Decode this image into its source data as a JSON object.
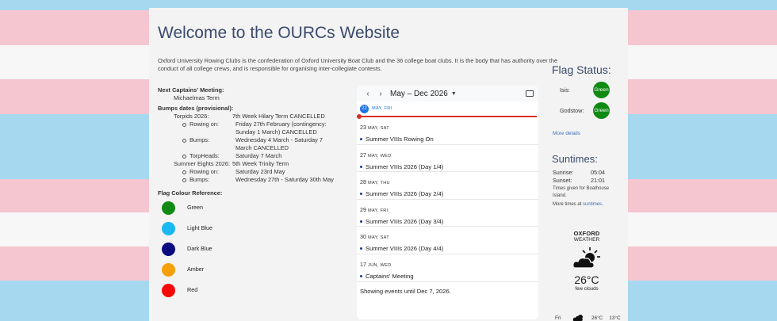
{
  "title": "Welcome to the OURCs Website",
  "intro": "Oxford University Rowing Clubs is the confederation of Oxford University Boat Club and the 36 college boat clubs. It is the body that has authority over the conduct of all college crews, and is responsible for organising inter-collegiate contests.",
  "meeting": {
    "label": "Next Captains' Meeting:",
    "value": "Michaelmas Term"
  },
  "bumps": {
    "label": "Bumps dates (provisional):",
    "torpids": {
      "name": "Torpids 2026:",
      "value": "7th Week Hilary Term CANCELLED",
      "items": [
        {
          "k": "Rowing on:",
          "v": "Friday 27th February (contingency: Sunday 1 March) CANCELLED"
        },
        {
          "k": "Bumps:",
          "v": "Wednesday 4 March - Saturday 7 March CANCELLED"
        },
        {
          "k": "TorpHeads:",
          "v": "Saturday 7 March"
        }
      ]
    },
    "eights": {
      "name": "Summer Eights 2026:",
      "value": "5th Week Trinity Term",
      "items": [
        {
          "k": "Rowing on:",
          "v": "Saturday 23rd May"
        },
        {
          "k": "Bumps:",
          "v": "Wednesday 27th - Saturday 30th May"
        }
      ]
    }
  },
  "flag_reference": {
    "label": "Flag Colour Reference:",
    "items": [
      {
        "name": "Green",
        "color": "#108a13"
      },
      {
        "name": "Light Blue",
        "color": "#1ab8f0"
      },
      {
        "name": "Dark Blue",
        "color": "#0a0a80"
      },
      {
        "name": "Amber",
        "color": "#f5a00a"
      },
      {
        "name": "Red",
        "color": "#f50a0a"
      }
    ]
  },
  "calendar": {
    "range": "May – Dec 2026",
    "today": {
      "num": "22",
      "label": "MAY, FRI"
    },
    "days": [
      {
        "num": "23",
        "label": "MAY, SAT",
        "event": "Summer VIIIs Rowing On"
      },
      {
        "num": "27",
        "label": "MAY, WED",
        "event": "Summer VIIIs 2026 (Day 1/4)"
      },
      {
        "num": "28",
        "label": "MAY, THU",
        "event": "Summer VIIIs 2026 (Day 2/4)"
      },
      {
        "num": "29",
        "label": "MAY, FRI",
        "event": "Summer VIIIs 2026 (Day 3/4)"
      },
      {
        "num": "30",
        "label": "MAY, SAT",
        "event": "Summer VIIIs 2026 (Day 4/4)"
      },
      {
        "num": "17",
        "label": "JUN, WED",
        "event": "Captains' Meeting"
      }
    ],
    "footer": "Showing events until Dec 7, 2026."
  },
  "flag_status": {
    "title": "Flag Status:",
    "rows": [
      {
        "name": "Isis:",
        "status": "Green"
      },
      {
        "name": "Godstow:",
        "status": "Green"
      }
    ],
    "more": "More details"
  },
  "suntimes": {
    "title": "Suntimes:",
    "sunrise_label": "Sunrise:",
    "sunrise": "05:04",
    "sunset_label": "Sunset:",
    "sunset": "21:01",
    "note": "Times given for Boathouse Island.",
    "more_prefix": "More times at",
    "more_link": "suntimes."
  },
  "weather": {
    "city": "OXFORD",
    "label": "WEATHER",
    "temp": "26°C",
    "desc": "few clouds",
    "forecast": {
      "day": "Fri",
      "high": "26°C",
      "low": "13°C"
    }
  }
}
